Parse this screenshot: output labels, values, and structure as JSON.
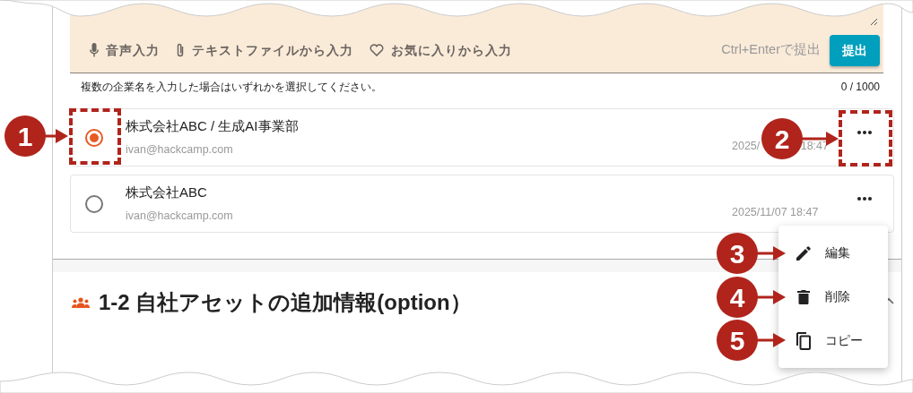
{
  "input_toolbar": {
    "actions": [
      {
        "kind": "mic",
        "label": "音声入力"
      },
      {
        "kind": "attach",
        "label": "テキストファイルから入力"
      },
      {
        "kind": "favorite",
        "label": "お気に入りから入力"
      }
    ],
    "shortcut_hint": "Ctrl+Enterで提出",
    "submit_button": "提出"
  },
  "helper_text": "複数の企業名を入力した場合はいずれかを選択してください。",
  "char_count": "0 / 1000",
  "companies": [
    {
      "name": "株式会社ABC / 生成AI事業部",
      "email": "ivan@hackcamp.com",
      "date_parts": [
        "2025/",
        "18:47"
      ],
      "selected": true
    },
    {
      "name": "株式会社ABC",
      "email": "ivan@hackcamp.com",
      "date_parts": [
        "2025/11/07 18:47"
      ],
      "selected": false
    }
  ],
  "row_menu": {
    "items": [
      {
        "kind": "edit",
        "label": "編集"
      },
      {
        "kind": "delete",
        "label": "削除"
      },
      {
        "kind": "copy",
        "label": "コピー"
      }
    ]
  },
  "section": {
    "title": "1-2 自社アセットの追加情報(option）",
    "expanded": true
  },
  "callouts": [
    {
      "number": "1"
    },
    {
      "number": "2"
    },
    {
      "number": "3"
    },
    {
      "number": "4"
    },
    {
      "number": "5"
    }
  ]
}
